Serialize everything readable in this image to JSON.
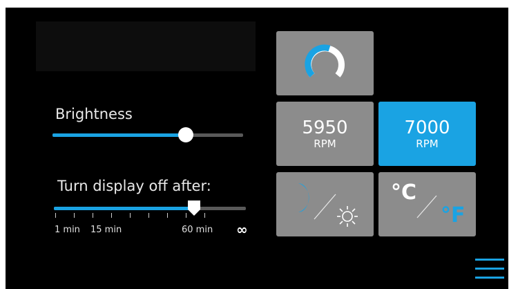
{
  "brightness": {
    "label": "Brightness",
    "level": 0.7
  },
  "display_off": {
    "label": "Turn display off after:",
    "level": 0.73,
    "ticks": [
      "1 min",
      "15 min",
      "60 min"
    ],
    "infinity": "∞"
  },
  "tiles": {
    "gauge_icon": "gauge-icon",
    "rpm_5950": {
      "value": "5950",
      "unit": "RPM"
    },
    "rpm_7000": {
      "value": "7000",
      "unit": "RPM"
    },
    "day_night_icon": "moon-sun-icon",
    "celsius": "°C",
    "fahrenheit": "°F"
  },
  "colors": {
    "accent": "#1aa3e3",
    "tile": "#8c8c8c",
    "background": "#000000"
  },
  "menu_icon": "hamburger-menu-icon"
}
